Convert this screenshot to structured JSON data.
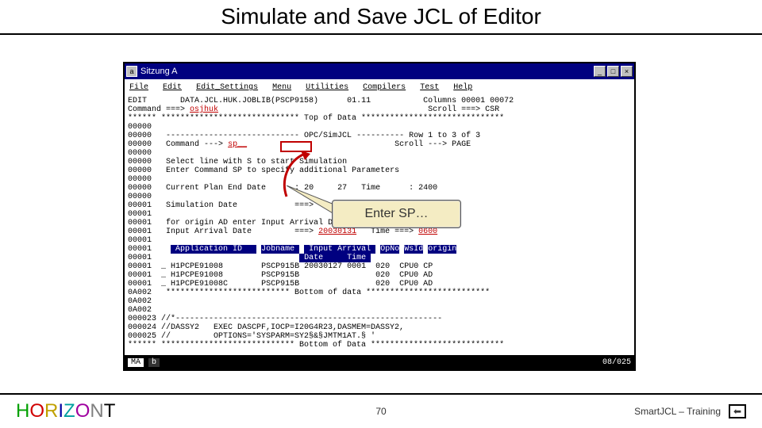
{
  "slide": {
    "title": "Simulate and Save JCL of Editor",
    "page_num": "70",
    "footer_right": "SmartJCL – Training",
    "logo": "HORIZONT"
  },
  "window": {
    "title": "Sitzung A"
  },
  "menubar": {
    "items": [
      "File",
      "Edit",
      "Edit_Settings",
      "Menu",
      "Utilities",
      "Compilers",
      "Test",
      "Help"
    ]
  },
  "editor": {
    "header_left": "EDIT",
    "dataset": "DATA.JCL.HUK.JOBLIB(PSCP9158)",
    "version": "01.11",
    "columns": "Columns 00001 00072",
    "cmd_label": "Command ===>",
    "cmd_val": "osjhuk",
    "scroll_label": "Scroll ===>",
    "scroll_val": "CSR",
    "top_stars": "****** ***************************** Top of Data ******************************",
    "panel_title": "OPC/SimJCL",
    "panel_row": "Row 1 to 3 of 3",
    "panel_scroll": "PAGE",
    "inner_cmd_label": "Command --->",
    "inner_cmd_val": "sp__",
    "help1": "Select line with S to start Simulation",
    "help2": "Enter Command SP to specify additional Parameters",
    "cped_label": "Current Plan End Date",
    "cped_date": "20     27",
    "cped_time_label": "Time",
    "cped_time": "2400",
    "sim_label": "Simulation Date",
    "sim_arrow": "===>",
    "origin_help": "for origin AD enter Input Arrival Date and Time below",
    "iad_label": "Input Arrival Date",
    "iad_date": "20030131",
    "iad_time": "0600",
    "tbl": {
      "h1": "Application ID",
      "h2": "Jobname",
      "h3": "Input Arrival",
      "h3b": "Date     Time",
      "h4": "OpNo",
      "h5": "WsId",
      "h6": "origin",
      "rows": [
        {
          "app": "H1PCPE91008",
          "job": "PSCP915B",
          "date": "20030127",
          "time": "0001",
          "op": "020",
          "ws": "CPU0",
          "org": "CP"
        },
        {
          "app": "H1PCPE91008",
          "job": "PSCP915B",
          "date": "",
          "time": "",
          "op": "020",
          "ws": "CPU0",
          "org": "AD"
        },
        {
          "app": "H1PCPE91008C",
          "job": "PSCP915B",
          "date": "",
          "time": "",
          "op": "020",
          "ws": "CPU0",
          "org": "AD"
        }
      ]
    },
    "bottom_sep": "************************** Bottom of data **************************",
    "tail_lines": [
      "000023 //*--------------------------------------------------------",
      "000024 //DASSY2   EXEC DASCPF,IOCP=I20G4R23,DASMEM=DASSY2,",
      "000025 //         OPTIONS='SYSPARM=SY2§&§JMTM1AT.§ '",
      "****** **************************** Bottom of Data ****************************"
    ],
    "line_nums": [
      "00000",
      "00000",
      "00000",
      "00000",
      "00000",
      "00000",
      "00000",
      "00000",
      "00000",
      "00001",
      "00001",
      "00001",
      "00001",
      "00001",
      "00001",
      "00001",
      "00001",
      "00001",
      "00001",
      "0A002",
      "0A002",
      "0A002"
    ]
  },
  "statusbar": {
    "left1": "MA",
    "left2": "b",
    "right": "08/025"
  },
  "callout": {
    "text": "Enter SP…"
  },
  "nav_icon": "⬅"
}
